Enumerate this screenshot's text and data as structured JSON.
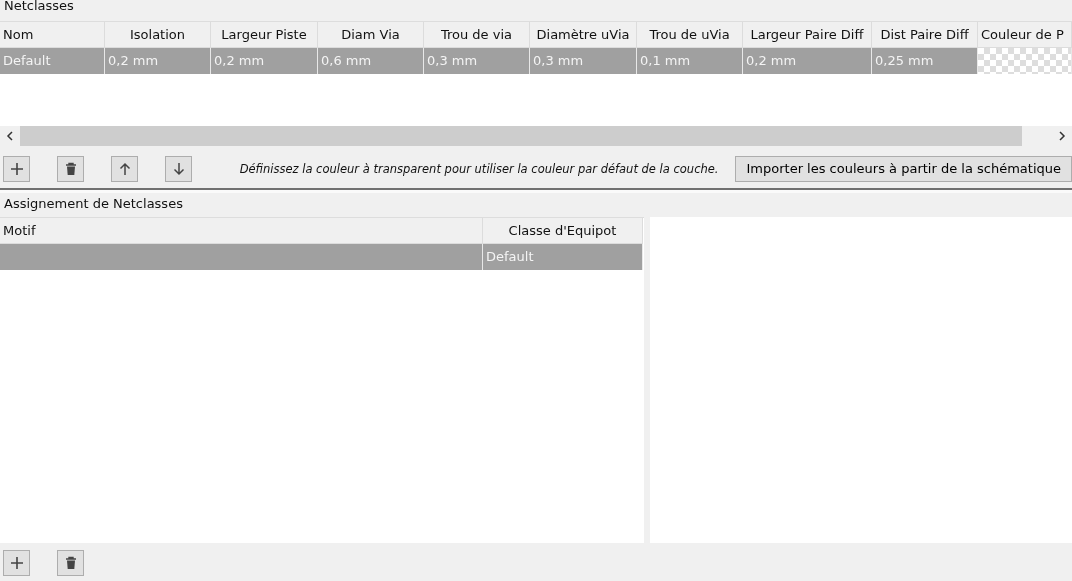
{
  "netclasses": {
    "title": "Netclasses",
    "columns": [
      "Nom",
      "Isolation",
      "Largeur Piste",
      "Diam Via",
      "Trou de via",
      "Diamètre uVia",
      "Trou de uVia",
      "Largeur Paire Diff",
      "Dist Paire Diff",
      "Couleur de P"
    ],
    "rows": [
      {
        "selected": true,
        "cells": [
          {
            "kind": "text",
            "text": "Default"
          },
          {
            "kind": "text",
            "text": "0,2 mm"
          },
          {
            "kind": "text",
            "text": "0,2 mm"
          },
          {
            "kind": "text",
            "text": "0,6 mm"
          },
          {
            "kind": "text",
            "text": "0,3 mm"
          },
          {
            "kind": "text",
            "text": "0,3 mm"
          },
          {
            "kind": "text",
            "text": "0,1 mm"
          },
          {
            "kind": "text",
            "text": "0,2 mm"
          },
          {
            "kind": "text",
            "text": "0,25 mm"
          },
          {
            "kind": "swatch"
          }
        ]
      }
    ],
    "toolbar": [
      {
        "kind": "add"
      },
      {
        "kind": "delete"
      },
      {
        "kind": "up"
      },
      {
        "kind": "down"
      }
    ],
    "hint": "Définissez la couleur à transparent pour utiliser la couleur par défaut de la couche.",
    "import_button": "Importer les couleurs à partir de la schématique"
  },
  "assignments": {
    "title": "Assignement de Netclasses",
    "columns": [
      "Motif",
      "Classe d'Equipot"
    ],
    "rows": [
      {
        "selected": true,
        "cells": [
          {
            "kind": "empty"
          },
          {
            "kind": "text",
            "text": "Default"
          }
        ]
      }
    ],
    "toolbar": [
      {
        "kind": "add"
      },
      {
        "kind": "delete"
      }
    ]
  }
}
